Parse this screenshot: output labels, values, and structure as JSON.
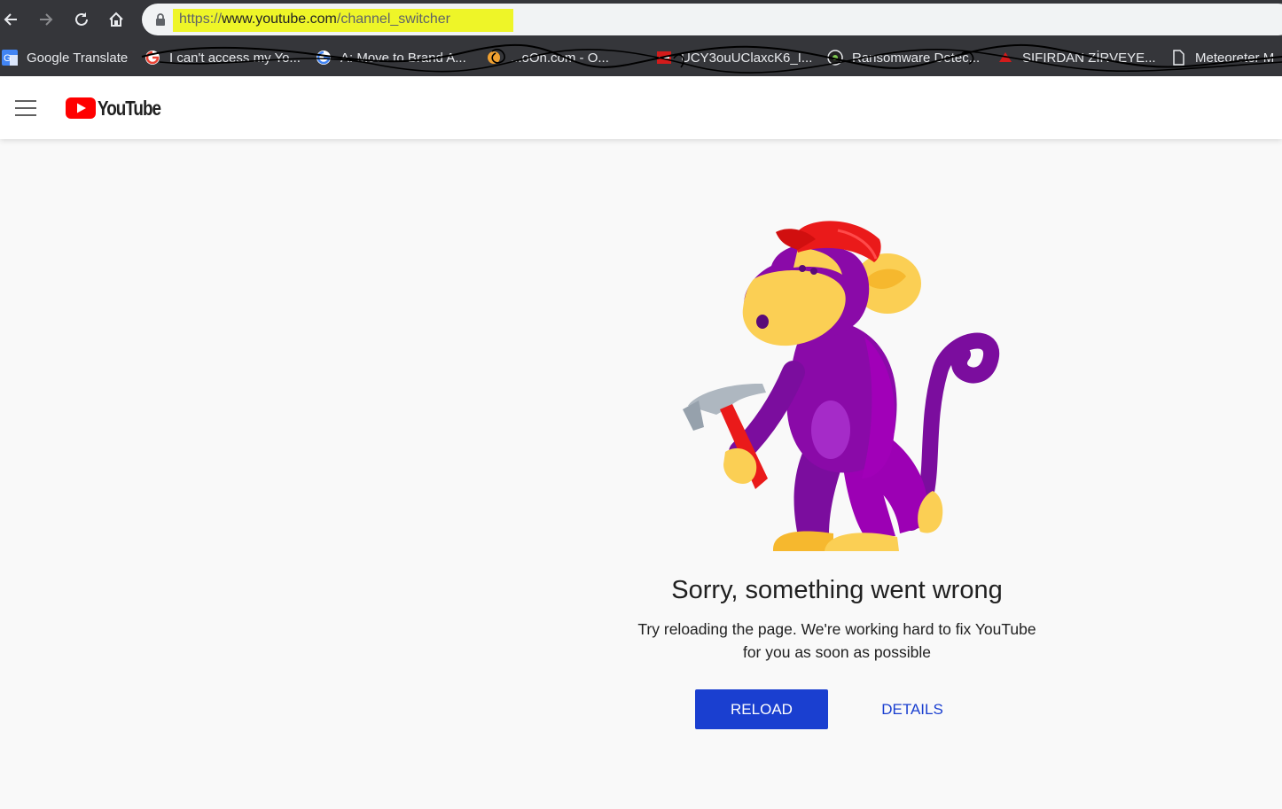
{
  "browser": {
    "url": {
      "scheme": "https://",
      "host": "www.youtube.com",
      "path": "/channel_switcher",
      "highlight_color": "#eef528"
    },
    "icons": [
      "back-icon",
      "forward-icon",
      "reload-icon",
      "home-icon",
      "lock-icon"
    ],
    "bookmarks": [
      {
        "label": "Google Translate",
        "icon": "google-translate-icon"
      },
      {
        "label": "I can't access my Yo...",
        "icon": "google-icon"
      },
      {
        "label": "A: Move to Brand A...",
        "icon": "google-icon"
      },
      {
        "label": "...oOn.com - O...",
        "icon": "site-icon"
      },
      {
        "label": "UCY3ouUClaxcK6_I...",
        "icon": "site-icon"
      },
      {
        "label": "Ransomware Detec...",
        "icon": "site-icon"
      },
      {
        "label": "SIFIRDAN ZİRVEYE...",
        "icon": "site-icon"
      },
      {
        "label": "Meteoreter M",
        "icon": "document-icon"
      }
    ]
  },
  "masthead": {
    "logo_text": "YouTube",
    "brand_color": "#ff0000"
  },
  "error": {
    "title": "Sorry, something went wrong",
    "message_line1": "Try reloading the page. We're working hard to fix YouTube",
    "message_line2": "for you as soon as possible",
    "reload_label": "RELOAD",
    "details_label": "DETAILS",
    "accent_color": "#1a3fd0"
  }
}
